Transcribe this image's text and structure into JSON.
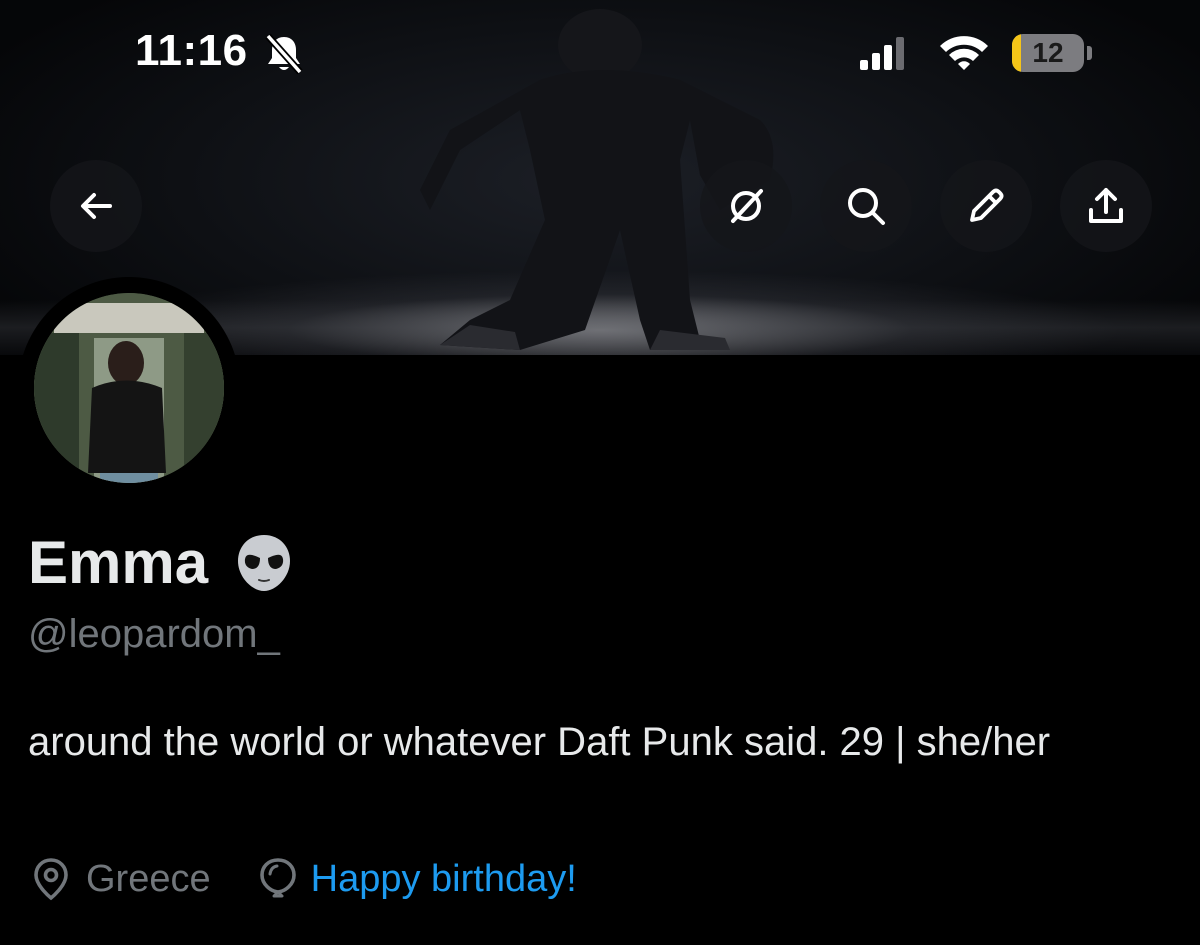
{
  "status_bar": {
    "time": "11:16",
    "battery_percent": "12",
    "battery_level": 0.12,
    "icons": [
      "bell-slash-icon",
      "cellular-signal-icon",
      "wifi-icon",
      "battery-icon"
    ]
  },
  "nav": {
    "buttons": [
      "back-arrow-icon",
      "grok-icon",
      "search-icon",
      "edit-pencil-icon",
      "share-icon"
    ]
  },
  "profile": {
    "display_name": "Emma",
    "name_emoji": "alien-face-icon",
    "handle": "@leopardom_",
    "bio": "around the world or whatever Daft Punk said. 29 | she/her",
    "location": "Greece",
    "birthday_text": "Happy birthday!"
  },
  "colors": {
    "background": "#000000",
    "text_primary": "#e7e9ea",
    "text_secondary": "#71767b",
    "link": "#1d9bf0",
    "battery_low": "#f5c518"
  }
}
